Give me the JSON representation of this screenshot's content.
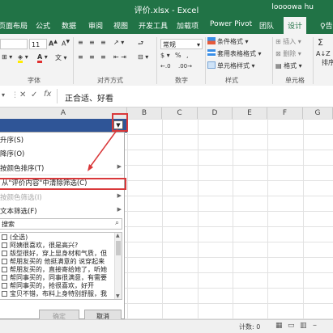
{
  "window": {
    "title": "评价.xlsx - Excel",
    "user": "loooowa hu"
  },
  "tabs": [
    "页面布局",
    "公式",
    "数据",
    "审阅",
    "视图",
    "开发工具",
    "加载项",
    "Power Pivot",
    "团队",
    "设计",
    "告"
  ],
  "ribbon": {
    "font_name": "",
    "font_size": "11",
    "font_group_label": "字体",
    "align_group_label": "对齐方式",
    "number_format": "常规",
    "number_group_label": "数字",
    "styles": {
      "cond_format": "条件格式",
      "table_format": "套用表格格式",
      "cell_styles": "单元格样式",
      "label": "样式"
    },
    "cells": {
      "insert": "插入",
      "delete": "删除",
      "format": "格式",
      "label": "单元格"
    },
    "sort_label": "排序"
  },
  "formula_bar": {
    "content": "正合适、好看"
  },
  "columns": [
    "A",
    "B",
    "C",
    "D",
    "E",
    "F",
    "G"
  ],
  "filter_menu": {
    "items": [
      {
        "label": "升序(S)",
        "disabled": false,
        "submenu": false
      },
      {
        "label": "降序(O)",
        "disabled": false,
        "submenu": false
      },
      {
        "label": "按颜色排序(T)",
        "disabled": false,
        "submenu": true
      },
      {
        "label": "从\"评价内容\"中清除筛选(C)",
        "disabled": false,
        "submenu": false
      },
      {
        "label": "按颜色筛选(I)",
        "disabled": true,
        "submenu": true
      },
      {
        "label": "文本筛选(F)",
        "disabled": false,
        "submenu": true
      }
    ],
    "search_placeholder": "搜索",
    "list": [
      "(全选)",
      "阿姨很喜欢，很是高兴?",
      "版型很好，穿上显身材和气质，但",
      "帮朋友买的 他挺满意的 说穿起来",
      "帮朋友买的，直接寄给她了，听她",
      "帮同事买的，同事很满意，有需要",
      "帮同事买的，抢很喜欢，好开",
      "宝贝不错，布料上身特别舒服，我"
    ],
    "ok": "确定",
    "cancel": "取消"
  },
  "status": {
    "count": "计数: 0"
  },
  "colors": {
    "accent": "#217346",
    "annotation": "#d9383a"
  }
}
